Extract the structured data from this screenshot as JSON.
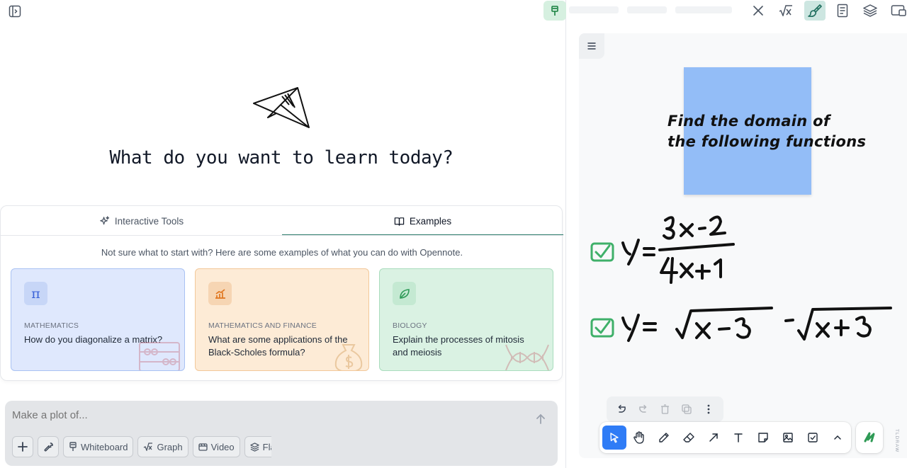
{
  "hero": {
    "title": "What do you want to learn today?"
  },
  "tabs": [
    {
      "label": "Interactive Tools",
      "icon": "sparkles-icon",
      "active": false
    },
    {
      "label": "Examples",
      "icon": "book-open-icon",
      "active": true
    }
  ],
  "examples": {
    "intro": "Not sure what to start with? Here are some examples of what you can do with Opennote.",
    "cards": [
      {
        "icon": "pi-icon",
        "icon_glyph": "π",
        "category": "MATHEMATICS",
        "question": "How do you diagonalize a matrix?",
        "color": "#dfe8fd"
      },
      {
        "icon": "chart-icon",
        "category": "MATHEMATICS AND FINANCE",
        "question": "What are some applications of the Black-Scholes formula?",
        "color": "#fdebd6"
      },
      {
        "icon": "leaf-icon",
        "category": "BIOLOGY",
        "question": "Explain the processes of mitosis and meiosis",
        "color": "#daf2e3"
      }
    ]
  },
  "composer": {
    "placeholder": "Make a plot of...",
    "tools": [
      {
        "label": "Whiteboard",
        "icon": "pin-icon"
      },
      {
        "label": "Graph",
        "icon": "sqrt-x-icon"
      },
      {
        "label": "Video",
        "icon": "film-icon"
      },
      {
        "label": "Flas",
        "icon": "layers-icon"
      }
    ]
  },
  "top_toolbar": {
    "buttons": [
      "close-icon",
      "sqrt-x-icon",
      "brush-icon",
      "notes-icon",
      "layers-icon",
      "window-icon"
    ],
    "active": "brush-icon",
    "accent": "#2f7d6c"
  },
  "whiteboard": {
    "sticky_note": {
      "line1": "Find the domain of",
      "line2": "the following functions",
      "color": "#93bdf7"
    },
    "handwriting": {
      "eq1": "y = (3x-2)/(4x+1)",
      "eq2": "y = √(x-3) - √(x+3)",
      "checkbox_color": "#3fb069"
    },
    "tools": [
      "select-icon",
      "hand-icon",
      "pencil-icon",
      "eraser-icon",
      "arrow-icon",
      "text-icon",
      "note-icon",
      "image-icon",
      "checkbox-icon",
      "chevron-up-icon"
    ],
    "active_tool": "select-icon",
    "active_color": "#2f7cf6",
    "watermark": "TLDRAW"
  }
}
